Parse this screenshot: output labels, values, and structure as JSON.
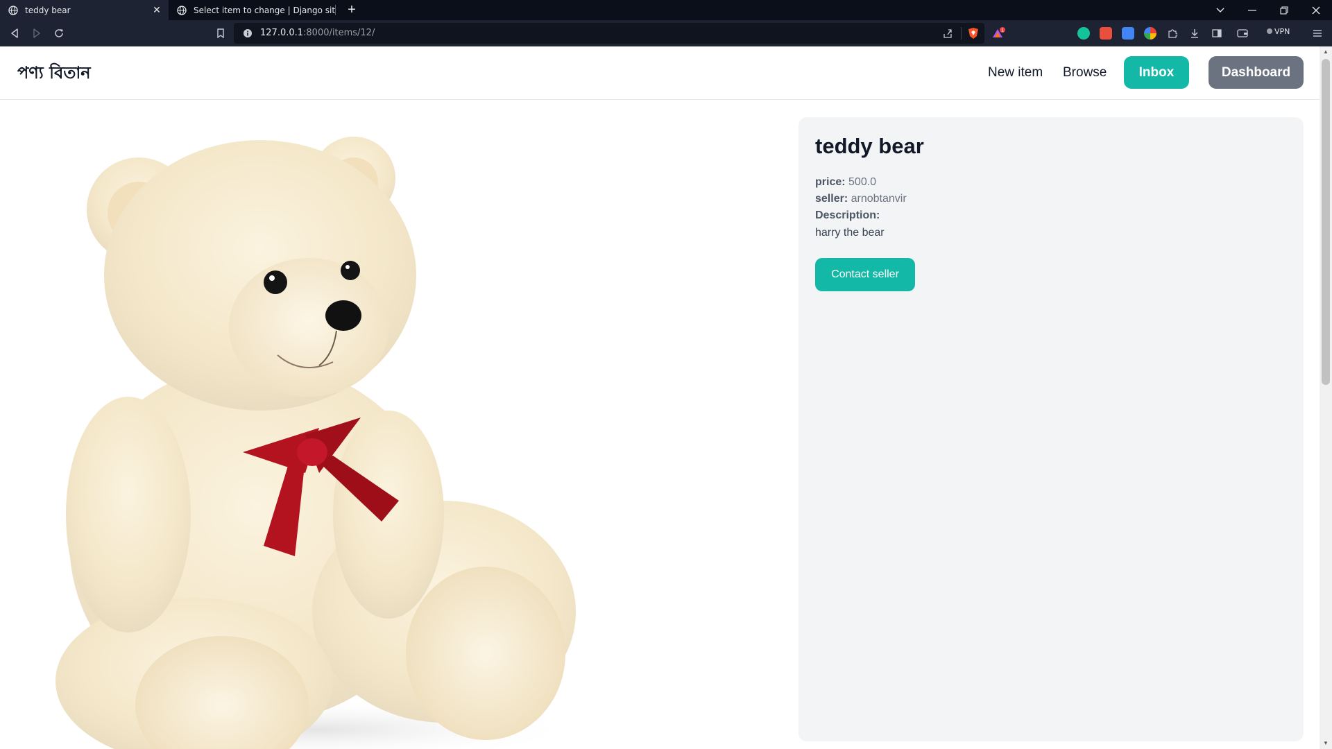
{
  "browser": {
    "tabs": [
      {
        "title": "teddy bear",
        "active": true
      },
      {
        "title": "Select item to change | Django site ad",
        "active": false
      }
    ],
    "url_host": "127.0.0.1",
    "url_rest": ":8000/items/12/",
    "vpn_label": "VPN",
    "notification_count": "1"
  },
  "navbar": {
    "brand": "পণ্য বিতান",
    "links": {
      "new_item": "New item",
      "browse": "Browse"
    },
    "inbox_label": "Inbox",
    "dashboard_label": "Dashboard"
  },
  "item": {
    "name": "teddy bear",
    "price_label": "price:",
    "price": "500.0",
    "seller_label": "seller:",
    "seller": "arnobtanvir",
    "description_label": "Description:",
    "description": "harry the bear",
    "contact_label": "Contact seller"
  },
  "colors": {
    "accent": "#14b8a6",
    "secondary": "#6b7280",
    "card_bg": "#f3f4f6",
    "ribbon": "#b3121f"
  }
}
